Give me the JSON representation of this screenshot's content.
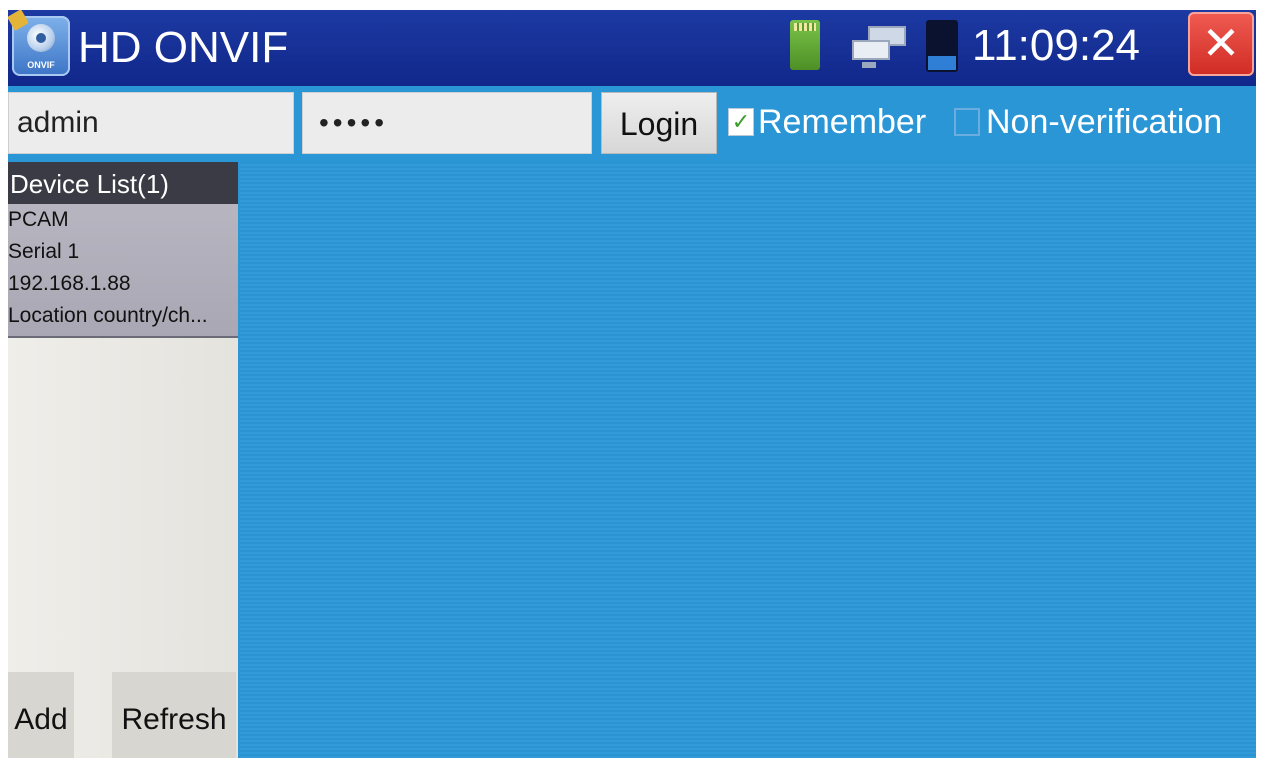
{
  "app": {
    "title": "HD ONVIF",
    "icon_label": "ONVIF",
    "clock": "11:09:24",
    "status_icons": [
      "sd-card-icon",
      "network-icon",
      "battery-icon"
    ],
    "close_icon": "close-icon"
  },
  "login": {
    "username": "admin",
    "password_mask": "•••••",
    "login_label": "Login",
    "remember_label": "Remember",
    "remember_checked": true,
    "nonverification_label": "Non-verification",
    "nonverification_checked": false
  },
  "device_list": {
    "header": "Device List(1)",
    "devices": [
      {
        "name": "PCAM",
        "serial": "Serial 1",
        "ip": "192.168.1.88",
        "location": "Location country/ch..."
      }
    ],
    "add_label": "Add",
    "refresh_label": "Refresh"
  },
  "colors": {
    "titlebar": "#1c3aa3",
    "background": "#2a96d6",
    "close": "#e0413a",
    "check": "#3a9c2a"
  }
}
